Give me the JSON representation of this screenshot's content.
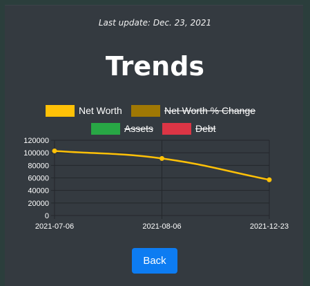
{
  "header": {
    "last_update": "Last update: Dec. 23, 2021",
    "title": "Trends"
  },
  "legend": [
    {
      "label": "Net Worth",
      "color": "#ffc107",
      "hidden": false
    },
    {
      "label": "Net Worth % Change",
      "color": "#a07804",
      "hidden": true
    },
    {
      "label": "Assets",
      "color": "#28a745",
      "hidden": true
    },
    {
      "label": "Debt",
      "color": "#dc3545",
      "hidden": true
    }
  ],
  "chart_data": {
    "type": "line",
    "categories": [
      "2021-07-06",
      "2021-08-06",
      "2021-12-23"
    ],
    "series": [
      {
        "name": "Net Worth",
        "values": [
          103000,
          91000,
          57000
        ],
        "color": "#ffc107"
      }
    ],
    "ylim": [
      0,
      120000
    ],
    "yticks": [
      0,
      20000,
      40000,
      60000,
      80000,
      100000,
      120000
    ],
    "grid": true
  },
  "actions": {
    "back_label": "Back"
  }
}
